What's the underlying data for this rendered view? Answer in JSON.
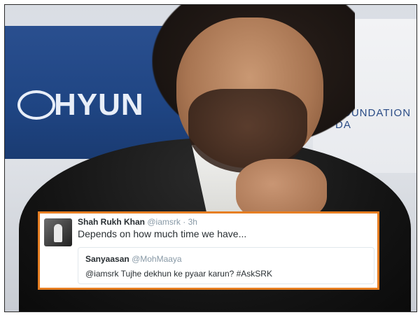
{
  "photo": {
    "brand_text": "HYUN",
    "banner_text": "FOUNDATION DA"
  },
  "tweet": {
    "author": {
      "name": "Shah Rukh Khan",
      "handle": "@iamsrk",
      "separator": "·",
      "time": "3h",
      "avatar_icon": "profile-photo"
    },
    "text": "Depends on how much time we have...",
    "quoted": {
      "name": "Sanyaasan",
      "handle": "@MohMaaya",
      "text": "@iamsrk Tujhe dekhun ke pyaar karun? #AskSRK"
    }
  },
  "colors": {
    "card_border": "#e67e22",
    "text_primary": "#292f33",
    "text_secondary": "#8899a6"
  }
}
